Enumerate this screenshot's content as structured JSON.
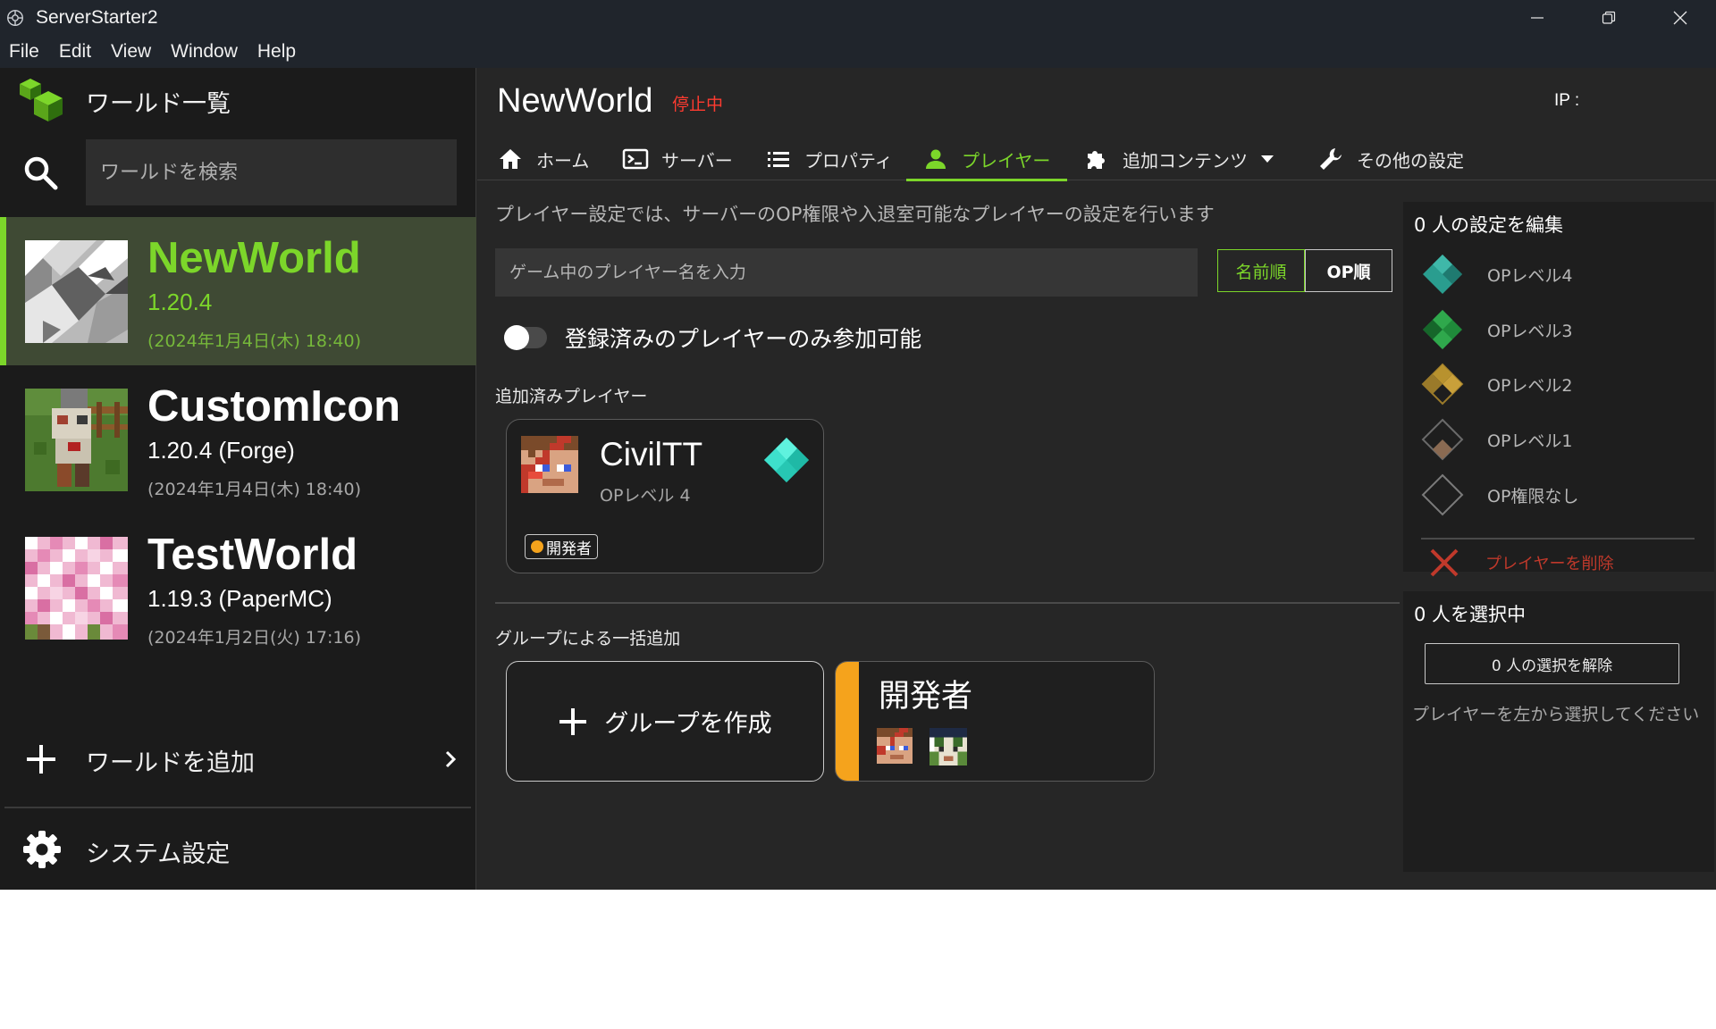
{
  "window": {
    "title": "ServerStarter2"
  },
  "menubar": {
    "items": [
      "File",
      "Edit",
      "View",
      "Window",
      "Help"
    ]
  },
  "sidebar": {
    "header": "ワールド一覧",
    "search_placeholder": "ワールドを検索",
    "worlds": [
      {
        "name": "NewWorld",
        "version": "1.20.4",
        "date": "(2024年1月4日(木) 18:40)",
        "selected": true
      },
      {
        "name": "CustomIcon",
        "version": "1.20.4 (Forge)",
        "date": "(2024年1月4日(木) 18:40)",
        "selected": false
      },
      {
        "name": "TestWorld",
        "version": "1.19.3 (PaperMC)",
        "date": "(2024年1月2日(火) 17:16)",
        "selected": false
      }
    ],
    "add_world": "ワールドを追加",
    "system_settings": "システム設定"
  },
  "main": {
    "world_title": "NewWorld",
    "status": "停止中",
    "ip": "IP :",
    "tabs": [
      {
        "label": "ホーム",
        "icon": "home-icon"
      },
      {
        "label": "サーバー",
        "icon": "console-icon"
      },
      {
        "label": "プロパティ",
        "icon": "list-icon"
      },
      {
        "label": "プレイヤー",
        "icon": "person-icon",
        "active": true
      },
      {
        "label": "追加コンテンツ",
        "icon": "puzzle-icon"
      },
      {
        "label": "その他の設定",
        "icon": "wrench-icon"
      }
    ],
    "description": "プレイヤー設定では、サーバーのOP権限や入退室可能なプレイヤーの設定を行います",
    "player_input_placeholder": "ゲーム中のプレイヤー名を入力",
    "sort": {
      "by_name": "名前順",
      "by_op": "OP順"
    },
    "whitelist_toggle": "登録済みのプレイヤーのみ参加可能",
    "added_players_label": "追加済みプレイヤー",
    "players": [
      {
        "name": "CivilTT",
        "op_level": "OPレベル 4",
        "group": "開発者"
      }
    ],
    "group_add_label": "グループによる一括追加",
    "create_group": "グループを作成",
    "groups": [
      {
        "name": "開発者",
        "color": "#f5a31c"
      }
    ]
  },
  "op_panel": {
    "title": "0 人の設定を編集",
    "levels": [
      "OPレベル4",
      "OPレベル3",
      "OPレベル2",
      "OPレベル1",
      "OP権限なし"
    ],
    "delete": "プレイヤーを削除"
  },
  "selection_panel": {
    "title": "0 人を選択中",
    "deselect": "0 人の選択を解除",
    "hint": "プレイヤーを左から選択してください"
  },
  "colors": {
    "accent": "#7cd62a",
    "status_stopped": "#ff3b30",
    "group": "#f5a31c"
  }
}
